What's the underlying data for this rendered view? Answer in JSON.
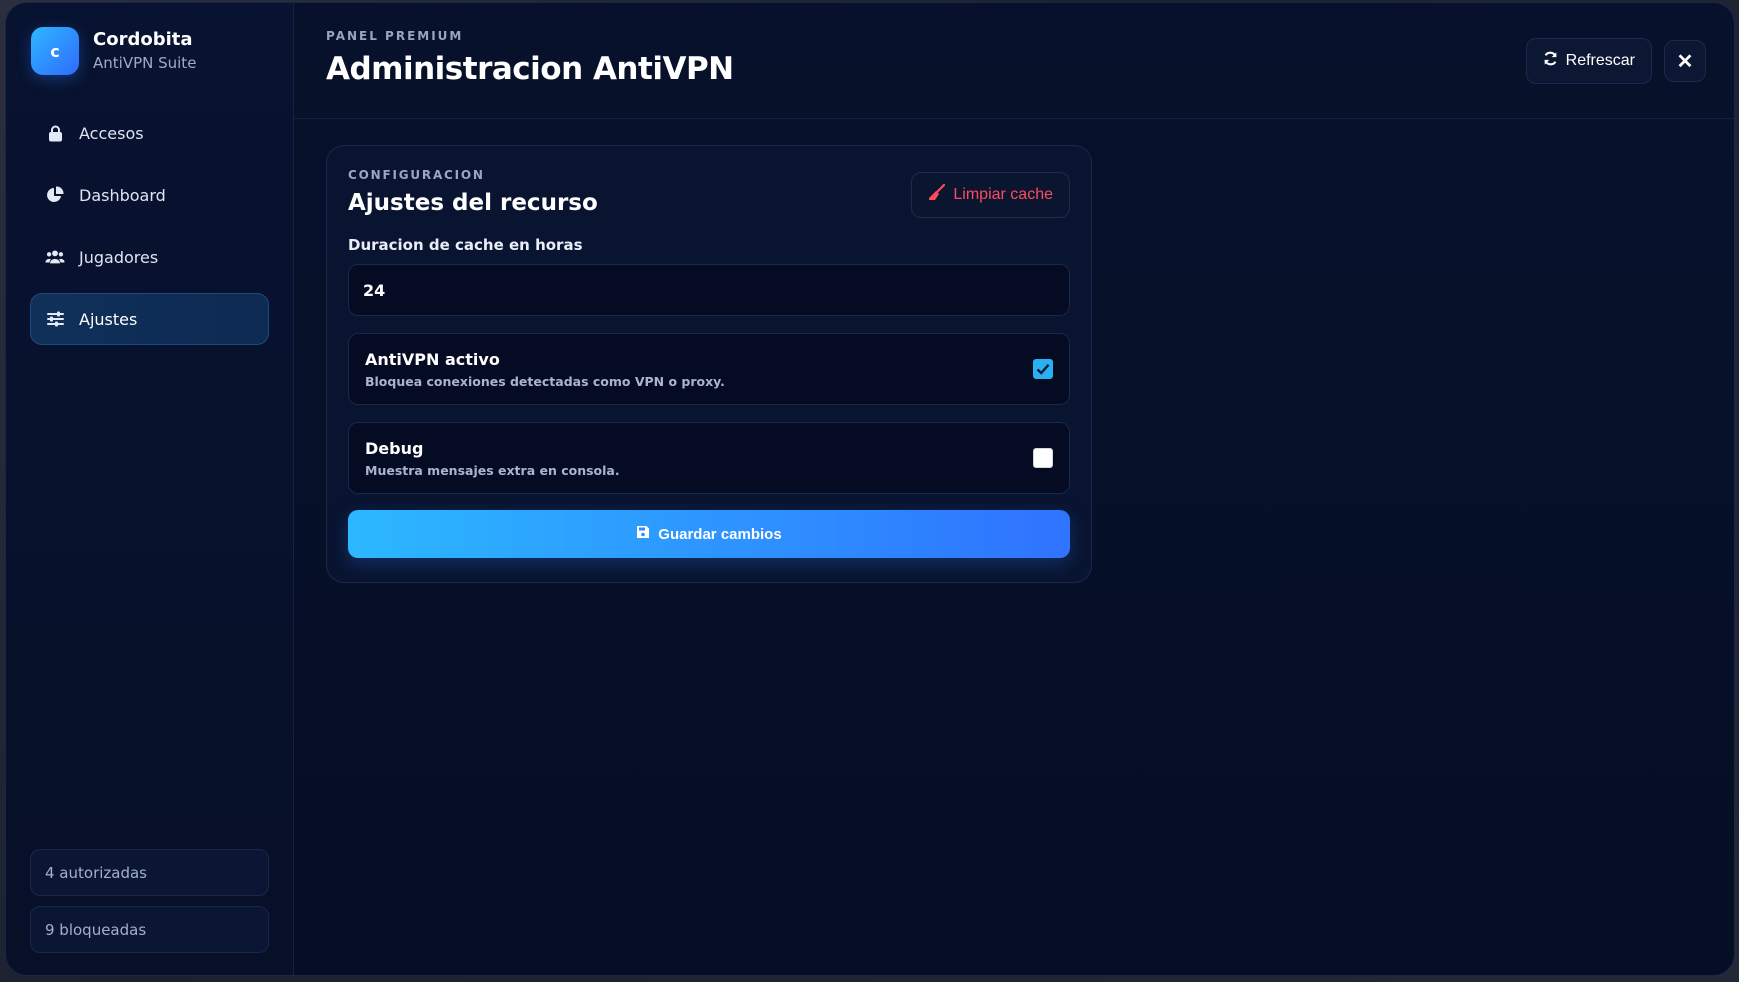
{
  "brand": {
    "logo_letter": "c",
    "name": "Cordobita",
    "subtitle": "AntiVPN Suite"
  },
  "sidebar": {
    "items": [
      {
        "label": "Accesos",
        "icon": "lock-icon",
        "active": false
      },
      {
        "label": "Dashboard",
        "icon": "pie-chart-icon",
        "active": false
      },
      {
        "label": "Jugadores",
        "icon": "users-icon",
        "active": false
      },
      {
        "label": "Ajustes",
        "icon": "sliders-icon",
        "active": true
      }
    ],
    "stats": {
      "authorized": "4 autorizadas",
      "blocked": "9 bloqueadas"
    }
  },
  "header": {
    "eyebrow": "PANEL PREMIUM",
    "title": "Administracion AntiVPN",
    "refresh_label": "Refrescar",
    "close_label": "✕"
  },
  "settings_card": {
    "eyebrow": "CONFIGURACION",
    "title": "Ajustes del recurso",
    "clear_cache_label": "Limpiar cache",
    "cache_duration": {
      "label": "Duracion de cache en horas",
      "value": "24"
    },
    "toggles": [
      {
        "title": "AntiVPN activo",
        "description": "Bloquea conexiones detectadas como VPN o proxy.",
        "checked": true
      },
      {
        "title": "Debug",
        "description": "Muestra mensajes extra en consola.",
        "checked": false
      }
    ],
    "save_label": "Guardar cambios"
  },
  "colors": {
    "accent": "#2cb8ff",
    "accent_end": "#2f73ff",
    "danger": "#ff4a5c",
    "background": "#07102a"
  }
}
